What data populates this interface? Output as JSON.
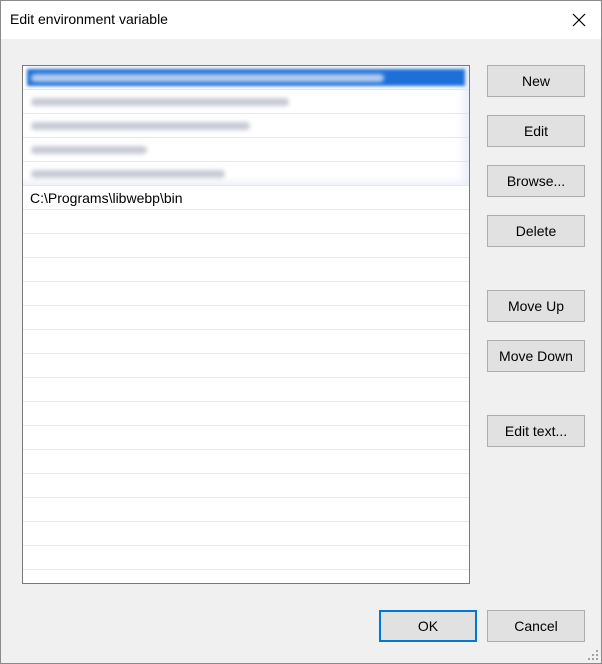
{
  "window": {
    "title": "Edit environment variable"
  },
  "entries": [
    {
      "text": "",
      "blurred": true,
      "selected": true,
      "bar_fraction": 0.82
    },
    {
      "text": "",
      "blurred": true,
      "selected": false,
      "bar_fraction": 0.6
    },
    {
      "text": "",
      "blurred": true,
      "selected": false,
      "bar_fraction": 0.51
    },
    {
      "text": "",
      "blurred": true,
      "selected": false,
      "bar_fraction": 0.27
    },
    {
      "text": "",
      "blurred": true,
      "selected": false,
      "bar_fraction": 0.45
    },
    {
      "text": "C:\\Programs\\libwebp\\bin",
      "blurred": false,
      "selected": false
    }
  ],
  "empty_rows": 16,
  "buttons": {
    "new": "New",
    "edit": "Edit",
    "browse": "Browse...",
    "delete": "Delete",
    "move_up": "Move Up",
    "move_down": "Move Down",
    "edit_text": "Edit text..."
  },
  "footer": {
    "ok": "OK",
    "cancel": "Cancel"
  },
  "colors": {
    "selection": "#1e6fd9",
    "default_button_border": "#0078d7"
  }
}
